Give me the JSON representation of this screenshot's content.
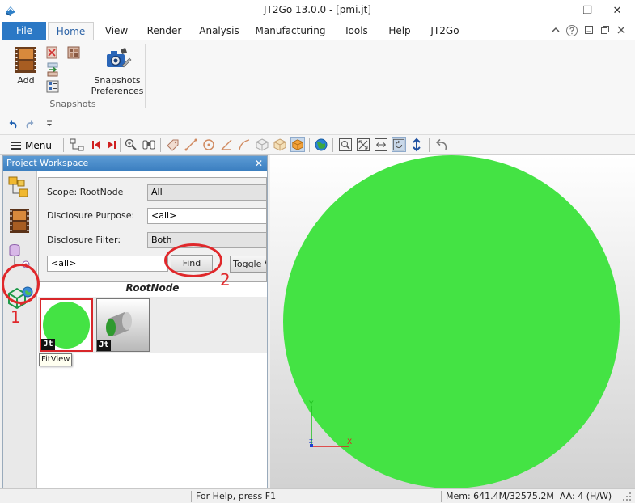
{
  "window": {
    "title": "JT2Go 13.0.0 - [pmi.jt]",
    "minimize_glyph": "—",
    "restore_glyph": "❐",
    "close_glyph": "✕"
  },
  "ribbon_tabs": [
    {
      "label": "File"
    },
    {
      "label": "Home"
    },
    {
      "label": "View"
    },
    {
      "label": "Render"
    },
    {
      "label": "Analysis"
    },
    {
      "label": "Manufacturing"
    },
    {
      "label": "Tools"
    },
    {
      "label": "Help"
    },
    {
      "label": "JT2Go"
    }
  ],
  "ribbon": {
    "add_label": "Add",
    "snapshots_prefs_line1": "Snapshots",
    "snapshots_prefs_line2": "Preferences",
    "group_label": "Snapshots"
  },
  "toolbar": {
    "menu_label": "Menu"
  },
  "workspace": {
    "title": "Project Workspace",
    "close_glyph": "✕",
    "scope_label": "Scope: RootNode",
    "scope_value": "All",
    "purpose_label": "Disclosure Purpose:",
    "purpose_value": "<all>",
    "filter_label": "Disclosure Filter:",
    "filter_value": "Both",
    "search_value": "<all>",
    "find_label": "Find",
    "toggle_label": "Toggle Vi",
    "root_label": "RootNode",
    "thumb_badge": "Jt",
    "tooltip": "FitView"
  },
  "annotations": {
    "num1": "1",
    "num2": "2"
  },
  "axes": {
    "y_label": "Y",
    "x_label": "X",
    "z_label": "Z"
  },
  "status": {
    "help": "For Help, press F1",
    "memory": "Mem: 641.4M/32575.2M  AA: 4 (H/W)"
  },
  "colors": {
    "accent": "#2b78c5",
    "model_green": "#44e344",
    "annotation_red": "#e0282b"
  }
}
